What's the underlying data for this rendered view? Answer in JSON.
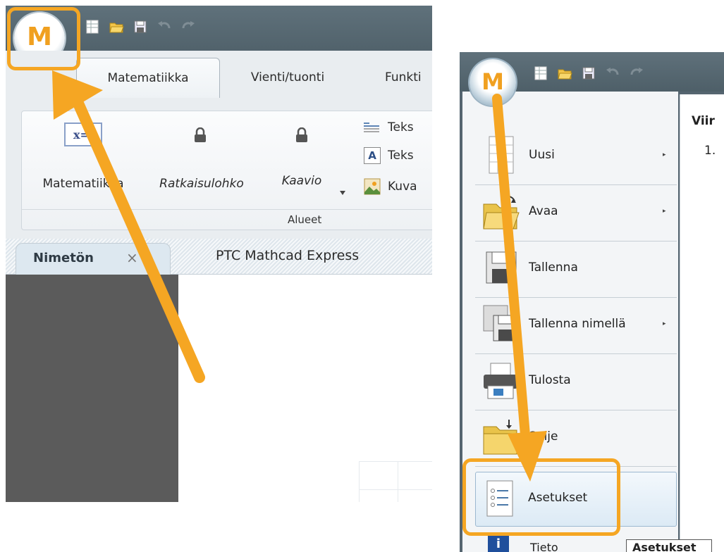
{
  "left_panel": {
    "tabs": [
      "Matematiikka",
      "Vienti/tuonti",
      "Funkti"
    ],
    "ribbon_items": {
      "math": "Matematiikka",
      "solve_block": "Ratkaisulohko",
      "chart": "Kaavio",
      "text_region_1": "Teks",
      "text_region_2": "Teks",
      "image": "Kuva",
      "group_label": "Alueet"
    },
    "document_tab": {
      "name": "Nimetön",
      "close_glyph": "×"
    },
    "app_title": "PTC Mathcad Express"
  },
  "right_panel": {
    "menu_items": [
      {
        "label": "Uusi",
        "has_submenu": true,
        "icon": "new-document-icon"
      },
      {
        "label": "Avaa",
        "has_submenu": true,
        "icon": "open-folder-icon"
      },
      {
        "label": "Tallenna",
        "has_submenu": false,
        "icon": "save-disk-icon"
      },
      {
        "label": "Tallenna nimellä",
        "has_submenu": true,
        "icon": "save-as-icon"
      },
      {
        "label": "Tulosta",
        "has_submenu": false,
        "icon": "printer-icon"
      },
      {
        "label": "Sulje",
        "has_submenu": false,
        "icon": "close-folder-icon"
      }
    ],
    "options_item": {
      "label": "Asetukset",
      "icon": "settings-list-icon"
    },
    "recent": {
      "heading": "Viir",
      "first_number": "1."
    },
    "tooltip": "Asetukset",
    "info_partial": "Tieto"
  },
  "submenu_glyph": "▸",
  "logo_text": "M",
  "colors": {
    "highlight": "#f5a623",
    "arrow": "#f5a623",
    "titlebar": "#55666f"
  }
}
